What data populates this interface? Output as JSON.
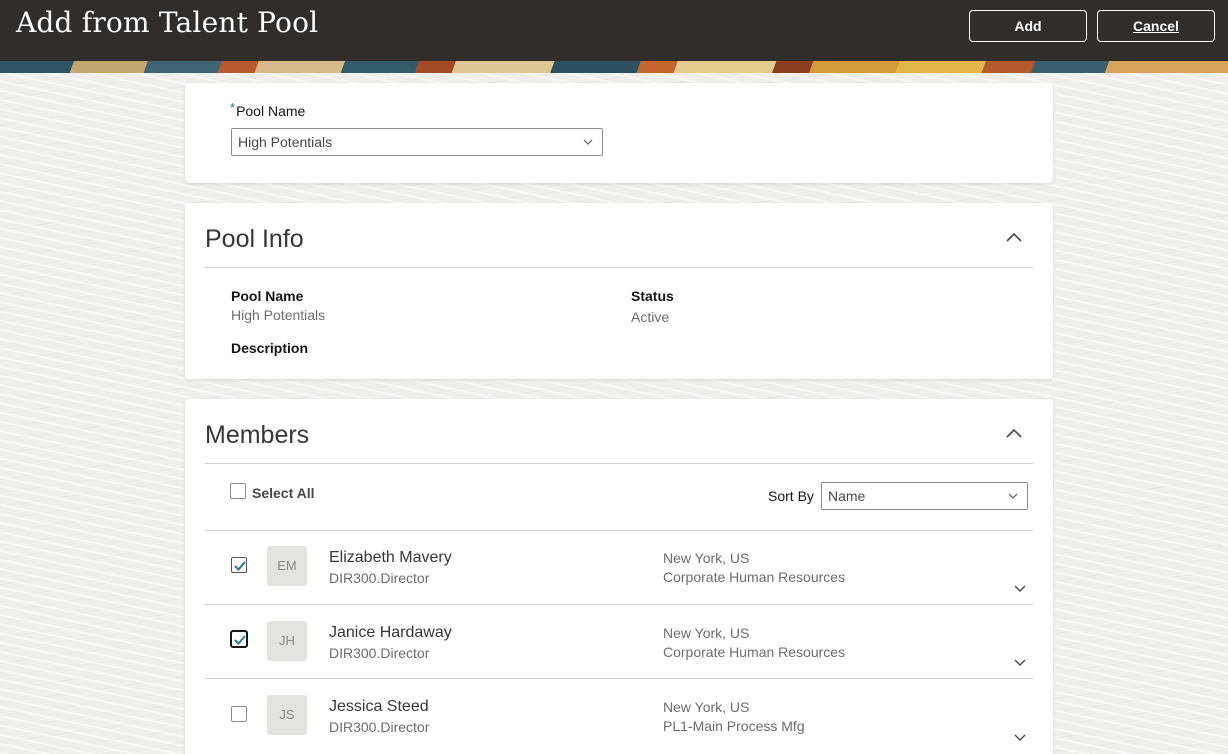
{
  "header": {
    "title": "Add from Talent Pool",
    "add_label": "Add",
    "cancel_label": "Cancel"
  },
  "pool_selector": {
    "label": "Pool Name",
    "required_mark": "*",
    "value": "High Potentials"
  },
  "pool_info": {
    "title": "Pool Info",
    "pool_name_label": "Pool Name",
    "pool_name_value": "High Potentials",
    "status_label": "Status",
    "status_value": "Active",
    "description_label": "Description"
  },
  "members": {
    "title": "Members",
    "select_all_label": "Select All",
    "select_all_checked": false,
    "sort_by_label": "Sort By",
    "sort_by_value": "Name",
    "items": [
      {
        "initials": "EM",
        "name": "Elizabeth Mavery",
        "job": "DIR300.Director",
        "location": "New York, US",
        "department": "Corporate Human Resources",
        "checked": true
      },
      {
        "initials": "JH",
        "name": "Janice Hardaway",
        "job": "DIR300.Director",
        "location": "New York, US",
        "department": "Corporate Human Resources",
        "checked": true
      },
      {
        "initials": "JS",
        "name": "Jessica Steed",
        "job": "DIR300.Director",
        "location": "New York, US",
        "department": "PL1-Main Process Mfg",
        "checked": false
      }
    ]
  },
  "colors": {
    "header_bg": "#312d2a",
    "accent": "#227e9e",
    "check": "#227e9e"
  }
}
